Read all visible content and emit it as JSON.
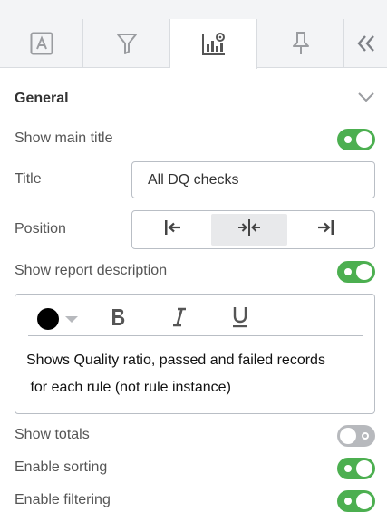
{
  "tabs": [
    {
      "name": "text-format-tab",
      "icon": "text-box-icon"
    },
    {
      "name": "filter-tab",
      "icon": "filter-funnel-icon"
    },
    {
      "name": "chart-settings-tab",
      "icon": "chart-settings-icon",
      "active": true
    },
    {
      "name": "pin-tab",
      "icon": "pin-icon"
    },
    {
      "name": "collapse-tab",
      "icon": "double-chevron-left-icon"
    }
  ],
  "section": {
    "title": "General",
    "expanded": true
  },
  "settings": {
    "show_main_title": {
      "label": "Show main title",
      "enabled": true
    },
    "title": {
      "label": "Title",
      "value": "All DQ checks"
    },
    "position": {
      "label": "Position",
      "options": [
        "align-left",
        "align-center",
        "align-right"
      ],
      "selected": "align-center"
    },
    "show_report_description": {
      "label": "Show report description",
      "enabled": true
    },
    "description": {
      "text_line1": "Shows Quality ratio, passed and failed records",
      "text_line2": " for each rule (not rule instance)",
      "text_color": "#000000"
    },
    "show_totals": {
      "label": "Show totals",
      "enabled": false
    },
    "enable_sorting": {
      "label": "Enable sorting",
      "enabled": true
    },
    "enable_filtering": {
      "label": "Enable filtering",
      "enabled": true
    }
  },
  "colors": {
    "toggle_on": "#4caf50",
    "toggle_off": "#b7b9bd",
    "tab_bar_bg": "#f3f4f6"
  }
}
